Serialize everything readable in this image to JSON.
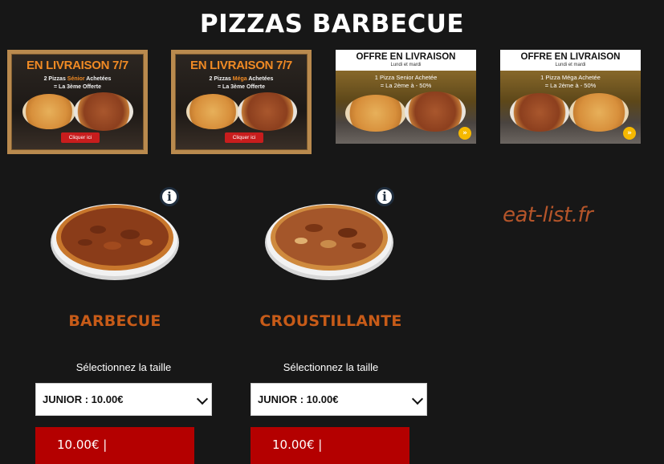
{
  "page": {
    "title": "PIZZAS BARBECUE"
  },
  "banners": [
    {
      "title": "EN LIVRAISON 7/7",
      "line1_pre": "2 Pizzas ",
      "line1_hl": "Sénior",
      "line1_post": " Achetées",
      "line2": "= La 3ème Offerte",
      "cta": "Cliquer ici"
    },
    {
      "title": "EN LIVRAISON 7/7",
      "line1_pre": "2 Pizzas ",
      "line1_hl": "Méga",
      "line1_post": " Achetées",
      "line2": "= La 3ème Offerte",
      "cta": "Cliquer ici"
    },
    {
      "title": "OFFRE EN LIVRAISON",
      "subtitle": "Lundi et mardi",
      "line1": "1 Pizza Senior Achetée",
      "line2": "= La 2ème à - 50%"
    },
    {
      "title": "OFFRE EN LIVRAISON",
      "subtitle": "Lundi et mardi",
      "line1": "1 Pizza Méga Achetée",
      "line2": "= La 2ème à - 50%"
    }
  ],
  "products": [
    {
      "name": "BARBECUE",
      "size_label": "Sélectionnez la taille",
      "size_selected": "JUNIOR : 10.00€",
      "price": "10.00€ |",
      "info_icon": "info-icon"
    },
    {
      "name": "CROUSTILLANTE",
      "size_label": "Sélectionnez la taille",
      "size_selected": "JUNIOR : 10.00€",
      "price": "10.00€ |",
      "info_icon": "info-icon"
    }
  ],
  "watermark": "eat-list.fr",
  "colors": {
    "background": "#171717",
    "accent_orange": "#c75b18",
    "price_red": "#b40000"
  }
}
